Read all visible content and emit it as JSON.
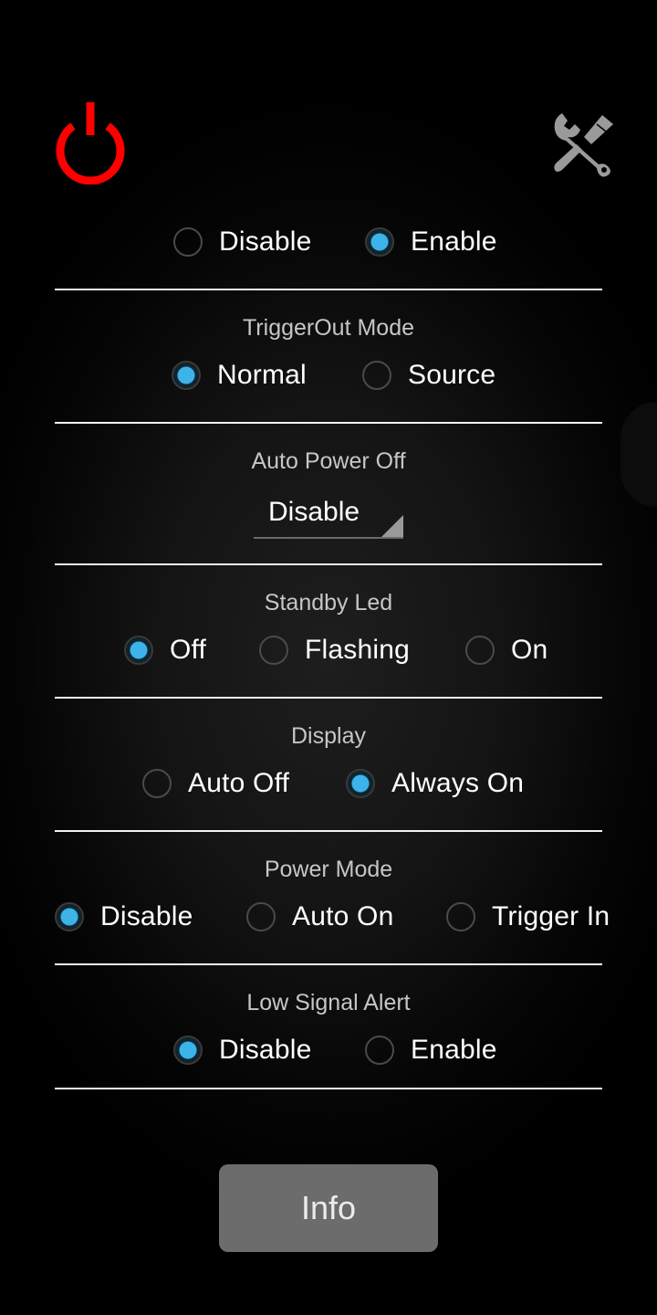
{
  "header": {
    "power_icon": "power-icon",
    "settings_icon": "wrench-screwdriver-icon",
    "accent_color": "#3cb4ea",
    "power_color": "#ff0000"
  },
  "main_switch": {
    "options": [
      {
        "label": "Disable",
        "checked": false
      },
      {
        "label": "Enable",
        "checked": true
      }
    ]
  },
  "trigger_out_mode": {
    "title": "TriggerOut Mode",
    "options": [
      {
        "label": "Normal",
        "checked": true
      },
      {
        "label": "Source",
        "checked": false
      }
    ]
  },
  "auto_power_off": {
    "title": "Auto Power Off",
    "selected": "Disable"
  },
  "standby_led": {
    "title": "Standby Led",
    "options": [
      {
        "label": "Off",
        "checked": true
      },
      {
        "label": "Flashing",
        "checked": false
      },
      {
        "label": "On",
        "checked": false
      }
    ]
  },
  "display": {
    "title": "Display",
    "options": [
      {
        "label": "Auto Off",
        "checked": false
      },
      {
        "label": "Always On",
        "checked": true
      }
    ]
  },
  "power_mode": {
    "title": "Power Mode",
    "options": [
      {
        "label": "Disable",
        "checked": true
      },
      {
        "label": "Auto On",
        "checked": false
      },
      {
        "label": "Trigger In",
        "checked": false
      }
    ]
  },
  "low_signal_alert": {
    "title": "Low Signal Alert",
    "options": [
      {
        "label": "Disable",
        "checked": true
      },
      {
        "label": "Enable",
        "checked": false
      }
    ]
  },
  "info_button": {
    "label": "Info"
  }
}
